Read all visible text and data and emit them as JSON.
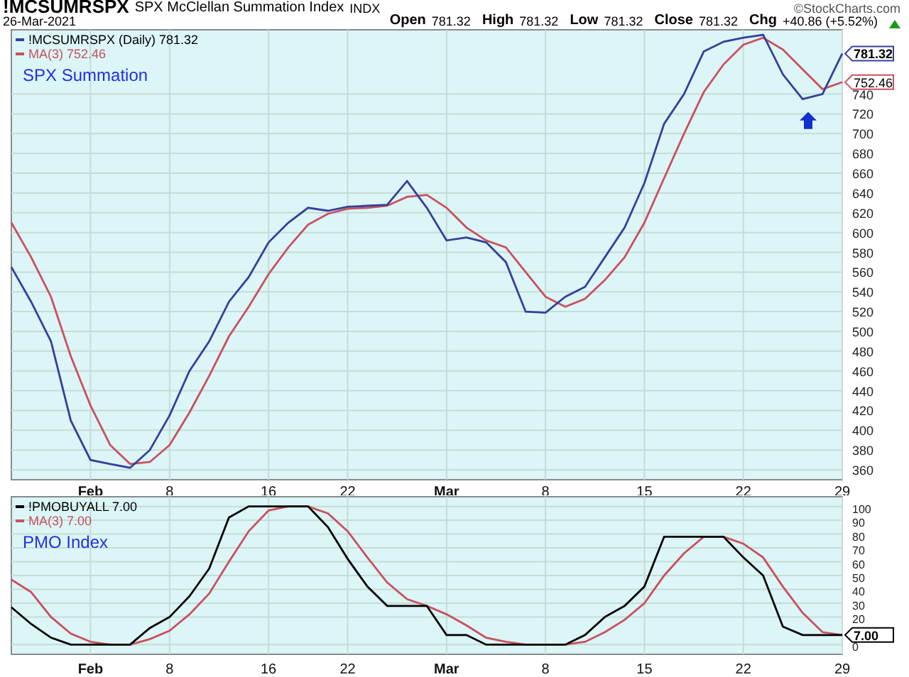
{
  "header": {
    "symbol": "!MCSUMRSPX",
    "name": "SPX McClellan Summation Index",
    "exchange": "INDX",
    "copyright": "©StockCharts.com",
    "date": "26-Mar-2021",
    "quote": [
      {
        "label": "Open",
        "value": "781.32"
      },
      {
        "label": "High",
        "value": "781.32"
      },
      {
        "label": "Low",
        "value": "781.32"
      },
      {
        "label": "Close",
        "value": "781.32"
      },
      {
        "label": "Chg",
        "value": "+40.86 (+5.52%)"
      }
    ]
  },
  "panels": [
    {
      "chart_data": {
        "type": "line",
        "title": "SPX Summation",
        "categories": [
          null,
          null,
          null,
          null,
          "Feb",
          null,
          null,
          null,
          "8",
          null,
          null,
          null,
          null,
          "16",
          null,
          null,
          null,
          "22",
          null,
          null,
          null,
          null,
          "Mar",
          null,
          null,
          null,
          null,
          "8",
          null,
          null,
          null,
          null,
          "15",
          null,
          null,
          null,
          null,
          "22",
          null,
          null,
          null,
          null,
          "29"
        ],
        "ylim": [
          350,
          805
        ],
        "grid": true,
        "legend": "upper left",
        "yticks": [
          360,
          380,
          400,
          420,
          440,
          460,
          480,
          500,
          520,
          540,
          560,
          580,
          600,
          620,
          640,
          660,
          680,
          700,
          720,
          740
        ],
        "series": [
          {
            "name": "!MCSUMRSPX (Daily) 781.32",
            "color": "#34409a",
            "values": [
              565,
              530,
              490,
              410,
              370,
              366,
              362,
              380,
              415,
              460,
              490,
              530,
              555,
              590,
              610,
              625,
              622,
              626,
              627,
              628,
              652,
              625,
              592,
              595,
              590,
              570,
              520,
              519,
              535,
              545,
              575,
              605,
              650,
              710,
              740,
              783,
              793,
              797,
              800,
              760,
              735,
              740,
              781
            ]
          },
          {
            "name": "MA(3) 752.46",
            "color": "#c9505f",
            "values": [
              610,
              575,
              535,
              475,
              425,
              385,
              366,
              368,
              385,
              418,
              455,
              495,
              525,
              558,
              585,
              608,
              619,
              624,
              625,
              627,
              636,
              638,
              625,
              605,
              592,
              585,
              560,
              535,
              525,
              533,
              552,
              575,
              610,
              655,
              700,
              742,
              770,
              790,
              797,
              785,
              765,
              745,
              752
            ]
          }
        ]
      },
      "price_tags": [
        {
          "text": "781.32",
          "color": "#34409a"
        },
        {
          "text": "752.46",
          "color": "#c9505f"
        }
      ]
    },
    {
      "chart_data": {
        "type": "line",
        "title": "PMO Index",
        "categories": [
          null,
          null,
          null,
          null,
          "Feb",
          null,
          null,
          null,
          "8",
          null,
          null,
          null,
          null,
          "16",
          null,
          null,
          null,
          "22",
          null,
          null,
          null,
          null,
          "Mar",
          null,
          null,
          null,
          null,
          "8",
          null,
          null,
          null,
          null,
          "15",
          null,
          null,
          null,
          null,
          "22",
          null,
          null,
          null,
          null,
          "29"
        ],
        "ylim": [
          -7,
          107
        ],
        "grid": true,
        "legend": "upper left",
        "yticks": [
          0,
          20,
          30,
          40,
          50,
          60,
          70,
          80,
          90,
          100
        ],
        "series": [
          {
            "name": "!PMOBUYALL 7.00",
            "color": "#000000",
            "values": [
              27,
              15,
              5,
              0,
              0,
              0,
              0,
              12,
              20,
              35,
              55,
              92,
              100,
              100,
              100,
              100,
              85,
              62,
              42,
              28,
              28,
              28,
              7,
              7,
              0,
              0,
              0,
              0,
              0,
              7,
              20,
              28,
              42,
              78,
              78,
              78,
              78,
              63,
              50,
              13,
              7,
              7,
              7
            ]
          },
          {
            "name": "MA(3) 7.00",
            "color": "#c9505f",
            "values": [
              47,
              38,
              20,
              8,
              2,
              0,
              0,
              4,
              10,
              22,
              37,
              60,
              82,
              97,
              100,
              100,
              95,
              82,
              63,
              45,
              33,
              28,
              22,
              14,
              5,
              2,
              0,
              0,
              0,
              2,
              9,
              18,
              30,
              50,
              66,
              78,
              78,
              73,
              63,
              42,
              23,
              9,
              7
            ]
          }
        ]
      },
      "price_tags": [
        {
          "text": "7.00",
          "color": "#000000"
        }
      ]
    }
  ]
}
